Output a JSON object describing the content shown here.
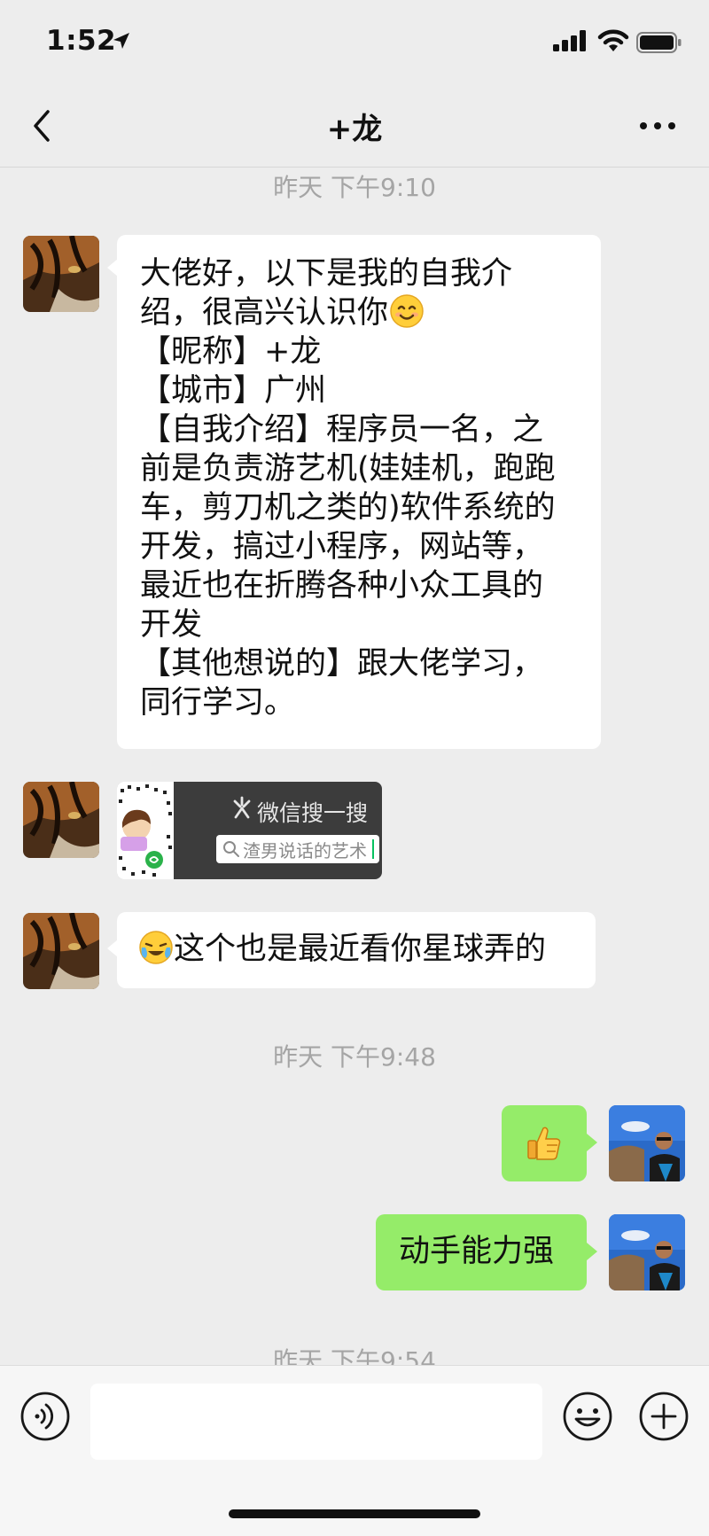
{
  "status_bar": {
    "time": "1:52"
  },
  "nav": {
    "title": "+龙"
  },
  "timestamps": [
    "昨天 下午9:10",
    "昨天 下午9:48",
    "昨天 下午9:54"
  ],
  "messages": [
    {
      "side": "left",
      "type": "text",
      "text": "大佬好，以下是我的自我介\n绍，很高兴认识你"
    },
    {
      "side": "left",
      "type": "text",
      "text": "【昵称】+龙\n【城市】广州\n【自我介绍】程序员一名，之\n前是负责游艺机(娃娃机，跑跑\n车，剪刀机之类的)软件系统的\n开发，搞过小程序，网站等，\n最近也在折腾各种小众工具的\n开发\n【其他想说的】跟大佬学习，\n同行学习。"
    },
    {
      "side": "left",
      "type": "mini-program",
      "brand": "微信搜一搜",
      "search_text": "渣男说话的艺术"
    },
    {
      "side": "left",
      "type": "text",
      "text": "这个也是最近看你星球弄的",
      "emoji": "crying-laughing-emoji"
    },
    {
      "side": "right",
      "type": "emoji",
      "emoji": "thumbs-up-emoji"
    },
    {
      "side": "right",
      "type": "text",
      "text": "动手能力强"
    }
  ],
  "colors": {
    "bg": "#ededed",
    "bubble_left": "#ffffff",
    "bubble_right": "#95ec69",
    "timestamp": "#a5a5a5"
  }
}
